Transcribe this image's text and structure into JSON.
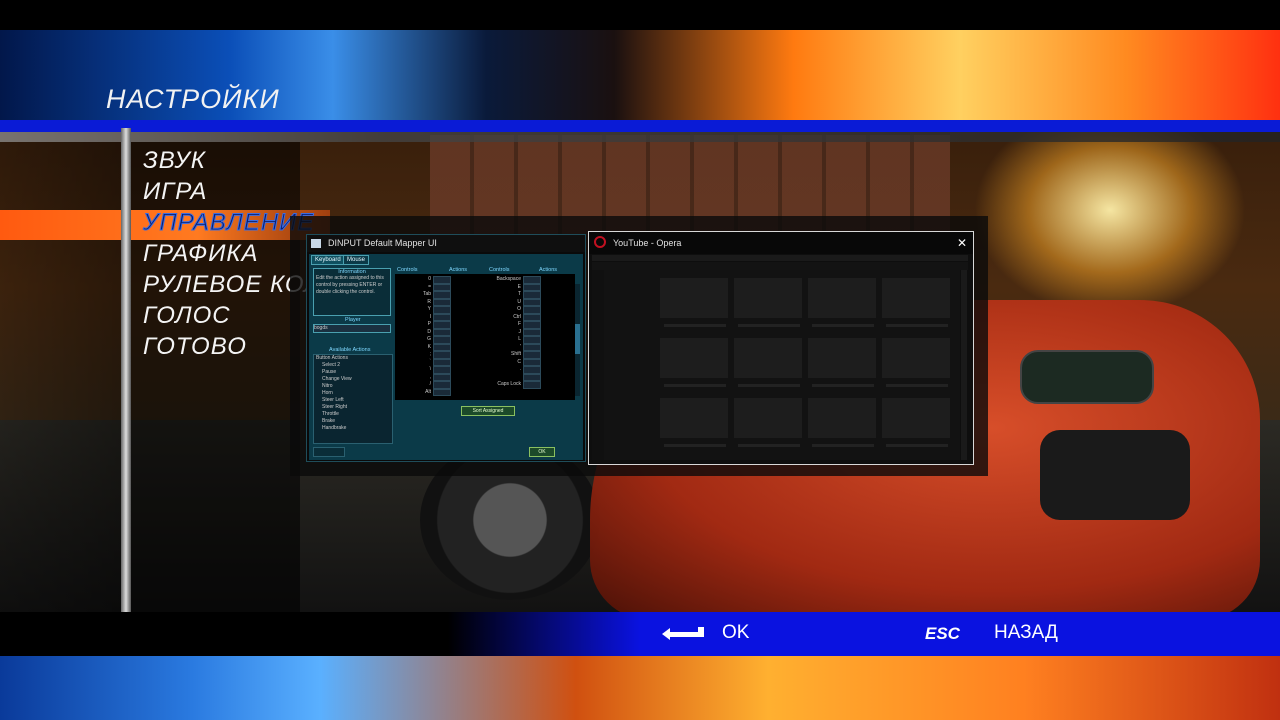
{
  "screen": {
    "title": "НАСТРОЙКИ"
  },
  "menu": {
    "items": [
      {
        "label": "ЗВУК",
        "active": false
      },
      {
        "label": "ИГРА",
        "active": false
      },
      {
        "label": "УПРАВЛЕНИЕ",
        "active": true
      },
      {
        "label": "ГРАФИКА",
        "active": false
      },
      {
        "label": "РУЛЕВОЕ КОЛ",
        "active": false
      },
      {
        "label": "ГОЛОС",
        "active": false
      },
      {
        "label": "ГОТОВО",
        "active": false
      }
    ]
  },
  "footer": {
    "ok_label": "OK",
    "esc_key": "ESC",
    "back_label": "НАЗАД"
  },
  "colors": {
    "accent_orange": "#ff6a18",
    "bar_blue": "#0a12e0",
    "active_text": "#0a2070"
  },
  "dinput": {
    "title": "DINPUT Default Mapper UI",
    "tabs": [
      "Keyboard",
      "Mouse"
    ],
    "info_header": "Information",
    "info_text": "Edit the action assigned to this control by pressing ENTER or double clicking the control.",
    "player_label": "Player",
    "player_value": "bogds",
    "available_actions_label": "Available Actions",
    "actions": [
      "Button Actions",
      "Select 2",
      "Pause",
      "Change View",
      "Nitro",
      "Horn",
      "Steer Left",
      "Steer Right",
      "Throttle",
      "Brake",
      "Handbrake"
    ],
    "col_headers": [
      "Controls",
      "Actions",
      "Controls",
      "Actions"
    ],
    "controls_left": [
      "0",
      "=",
      "Tab",
      "R",
      "Y",
      "I",
      "P",
      "D",
      "G",
      "K",
      ";",
      "`",
      "\\",
      ",",
      "/",
      "Alt"
    ],
    "controls_right": [
      "Backspace",
      "E",
      "T",
      "U",
      "O",
      "Ctrl",
      "F",
      "J",
      "L",
      "'",
      "Shift",
      "C",
      ".",
      "",
      "Caps Lock"
    ],
    "sort_label": "Sort Assigned",
    "ok_button": "OK"
  },
  "opera": {
    "title": "YouTube - Opera",
    "close_icon": "close-icon"
  }
}
